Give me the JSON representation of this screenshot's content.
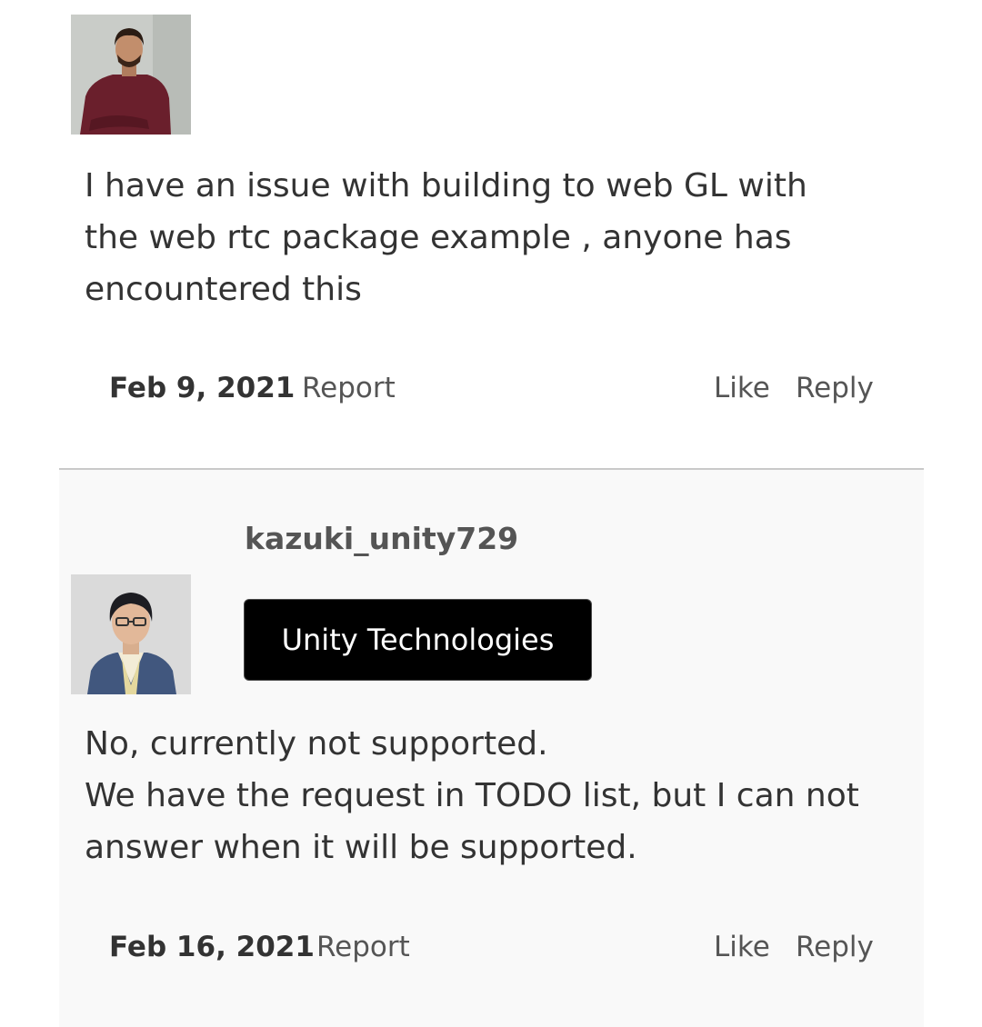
{
  "posts": [
    {
      "avatar_icon": "user-photo-avatar",
      "body_lines": [
        "I have an issue with building to web GL with",
        "the web rtc package example , anyone has",
        "encountered this"
      ],
      "date": "Feb 9, 2021",
      "report_label": "Report",
      "like_label": "Like",
      "reply_label": "Reply"
    },
    {
      "username": "kazuki_unity729",
      "badge": "Unity Technologies",
      "avatar_icon": "user-photo-avatar",
      "body_lines": [
        "No, currently not supported.",
        "We have the request in TODO list, but I can not",
        "answer when it will be supported."
      ],
      "date": "Feb 16, 2021",
      "report_label": "Report",
      "like_label": "Like",
      "reply_label": "Reply"
    }
  ],
  "colors": {
    "text": "#333333",
    "muted": "#555555",
    "reply_background": "#f9f9f9",
    "divider": "#c9c9c9",
    "badge_background": "#000000",
    "badge_text": "#ffffff"
  }
}
